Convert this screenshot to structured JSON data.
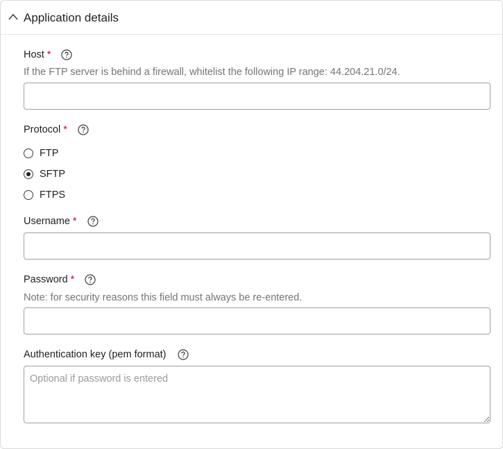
{
  "section": {
    "title": "Application details",
    "toggle_icon": "chevron-up-icon"
  },
  "host": {
    "label": "Host",
    "required_mark": "*",
    "hint": "If the FTP server is behind a firewall, whitelist the following IP range: 44.204.21.0/24.",
    "value": ""
  },
  "protocol": {
    "label": "Protocol",
    "required_mark": "*",
    "options": [
      {
        "label": "FTP",
        "selected": false
      },
      {
        "label": "SFTP",
        "selected": true
      },
      {
        "label": "FTPS",
        "selected": false
      }
    ]
  },
  "username": {
    "label": "Username",
    "required_mark": "*",
    "value": ""
  },
  "password": {
    "label": "Password",
    "required_mark": "*",
    "hint": "Note: for security reasons this field must always be re-entered.",
    "value": ""
  },
  "auth_key": {
    "label": "Authentication key (pem format)",
    "placeholder": "Optional if password is entered",
    "value": ""
  },
  "colors": {
    "required": "#d0021b",
    "hint_text": "#747474",
    "border": "#9f9f9f"
  }
}
